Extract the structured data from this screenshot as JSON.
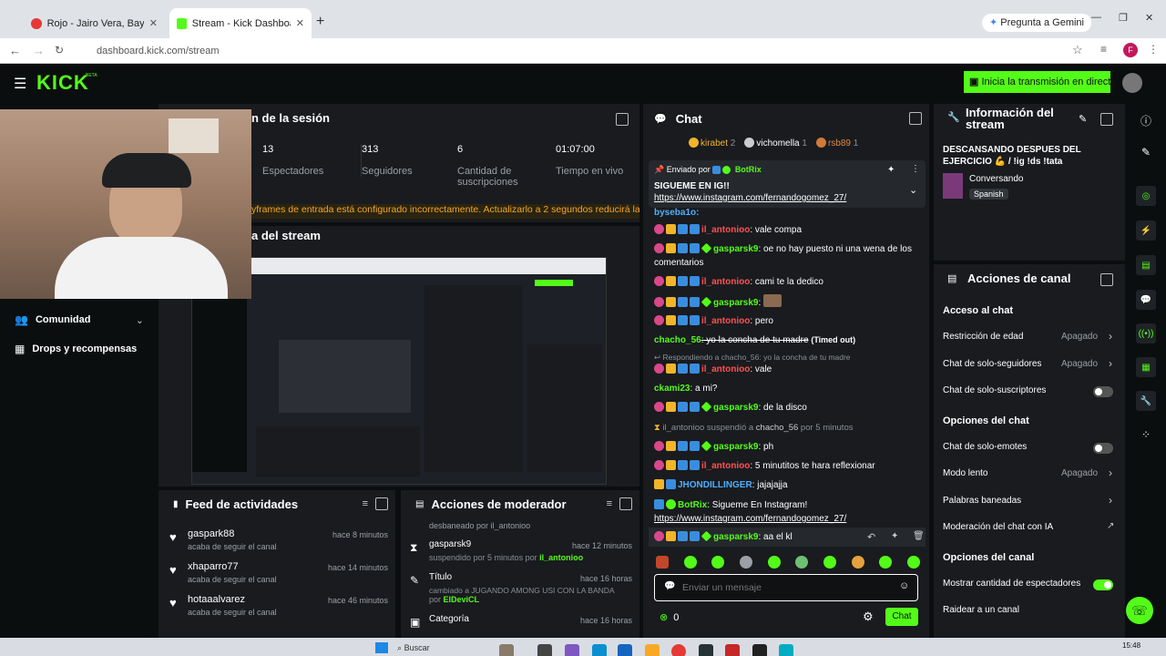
{
  "browser": {
    "tabs": [
      {
        "label": "Rojo - Jairo Vera, Bayriton, ..."
      },
      {
        "label": "Stream - Kick Dashboard"
      }
    ],
    "gemini_label": "Pregunta a Gemini",
    "url": "dashboard.kick.com/stream",
    "profile_initial": "F"
  },
  "header": {
    "logo": "KICK",
    "logo_sup": "BETA",
    "live_button": "Inicia la transmisión en directo"
  },
  "session": {
    "title": "n de la sesión",
    "stats": [
      {
        "value": "13",
        "label": "Espectadores"
      },
      {
        "value": "313",
        "label": "Seguidores"
      },
      {
        "value": "6",
        "label": "Cantidad de suscripciones"
      },
      {
        "value": "01:07:00",
        "label": "Tiempo en vivo"
      }
    ],
    "warning": "yframes de entrada está configurado incorrectamente. Actualizarlo a 2 segundos reducirá la"
  },
  "preview": {
    "title": "a del stream"
  },
  "sidebar": {
    "items": [
      {
        "label": "Comunidad"
      },
      {
        "label": "Drops y recompensas"
      }
    ]
  },
  "feed": {
    "title": "Feed de actividades",
    "items": [
      {
        "user": "gaspark88",
        "action": "acaba de seguir el canal",
        "time": "hace 8 minutos"
      },
      {
        "user": "xhaparro77",
        "action": "acaba de seguir el canal",
        "time": "hace 14 minutos"
      },
      {
        "user": "hotaaalvarez",
        "action": "acaba de seguir el canal",
        "time": "hace 46 minutos"
      }
    ]
  },
  "modactions": {
    "title": "Acciones de moderador",
    "top_line": "desbaneado por il_antonioo",
    "items": [
      {
        "user": "gasparsk9",
        "detail": "suspendido por 5 minutos por",
        "by": "il_antonioo",
        "time": "hace 12 minutos"
      },
      {
        "user": "Título",
        "detail": "cambiado a JUGANDO AMONG USI CON LA BANDA",
        "by": "ElDeviCL",
        "by_prefix": "por",
        "time": "hace 16 horas"
      },
      {
        "user": "Categoría",
        "detail": "",
        "by": "",
        "time": "hace 16 horas"
      }
    ]
  },
  "chat": {
    "title": "Chat",
    "top_users": [
      {
        "name": "kirabet",
        "n": "2"
      },
      {
        "name": "vichomella",
        "n": "1"
      },
      {
        "name": "rsb89",
        "n": "1"
      }
    ],
    "pinned": {
      "by_label": "Enviado por",
      "by_user": "BotRix",
      "text": "SIGUEME EN IG!!",
      "link": "https://www.instagram.com/fernandogomez_27/"
    },
    "partial_top": "byseba1o:",
    "messages": [
      {
        "user": "il_antonioo",
        "text": ": vale compa"
      },
      {
        "user": "gasparsk9",
        "text": ": oe no hay puesto ni una wena de los"
      },
      {
        "user": "",
        "text": "comentarios"
      },
      {
        "user": "il_antonioo",
        "text": ": cami te la dedico"
      },
      {
        "user": "gasparsk9",
        "text": ":"
      },
      {
        "user": "il_antonioo",
        "text": ": pero"
      },
      {
        "user": "chacho_56",
        "text": ": yo la concha de tu madre",
        "suffix": "(Timed out)"
      },
      {
        "user": "",
        "text": "Respondiendo a chacho_56: yo la concha de tu madre"
      },
      {
        "user": "il_antonioo",
        "text": ": vale"
      },
      {
        "user": "ckami23",
        "text": ": a mi?"
      },
      {
        "user": "gasparsk9",
        "text": ": de la disco"
      },
      {
        "user": "il_antonioo",
        "text": " suspendió a ",
        "target": "chacho_56",
        "tail": " por 5 minutos"
      },
      {
        "user": "gasparsk9",
        "text": ": ph"
      },
      {
        "user": "il_antonioo",
        "text": ": 5 minutitos te hara reflexionar"
      },
      {
        "user": "JHONDILLINGER",
        "text": ": jajajajja"
      },
      {
        "user": "BotRix",
        "text": ": Sigueme En Instagram!"
      },
      {
        "user": "",
        "text": "https://www.instagram.com/fernandogomez_27/"
      },
      {
        "user": "gasparsk9",
        "text": ": aa el kl"
      }
    ],
    "input_placeholder": "Enviar un mensaje",
    "count": "0",
    "send_label": "Chat"
  },
  "info": {
    "title": "Información del stream",
    "stream_title": "DESCANSANDO DESPUES DEL EJERCICIO 💪 / !ig !ds !tata",
    "category": "Conversando",
    "language": "Spanish"
  },
  "channel": {
    "title": "Acciones de canal",
    "sections": [
      {
        "heading": "Acceso al chat"
      },
      {
        "heading": "Opciones del chat"
      },
      {
        "heading": "Opciones del canal"
      }
    ],
    "rows": [
      {
        "label": "Restricción de edad",
        "value": "Apagado"
      },
      {
        "label": "Chat de solo-seguidores",
        "value": "Apagado"
      },
      {
        "label": "Chat de solo-suscriptores",
        "value": ""
      },
      {
        "label": "Chat de solo-emotes",
        "value": ""
      },
      {
        "label": "Modo lento",
        "value": "Apagado"
      },
      {
        "label": "Palabras baneadas",
        "value": ""
      },
      {
        "label": "Moderación del chat con IA",
        "value": ""
      },
      {
        "label": "Mostrar cantidad de espectadores",
        "value": ""
      },
      {
        "label": "Raidear a un canal",
        "value": ""
      }
    ],
    "toggles": {
      "solo_suscriptores": false,
      "solo_emotes": false,
      "mostrar_espectadores": true
    }
  },
  "taskbar": {
    "search": "Buscar",
    "time": "15:48"
  },
  "colors": {
    "accent": "#53fc18",
    "panel": "#191b1f",
    "bg": "#0b0e0f"
  }
}
